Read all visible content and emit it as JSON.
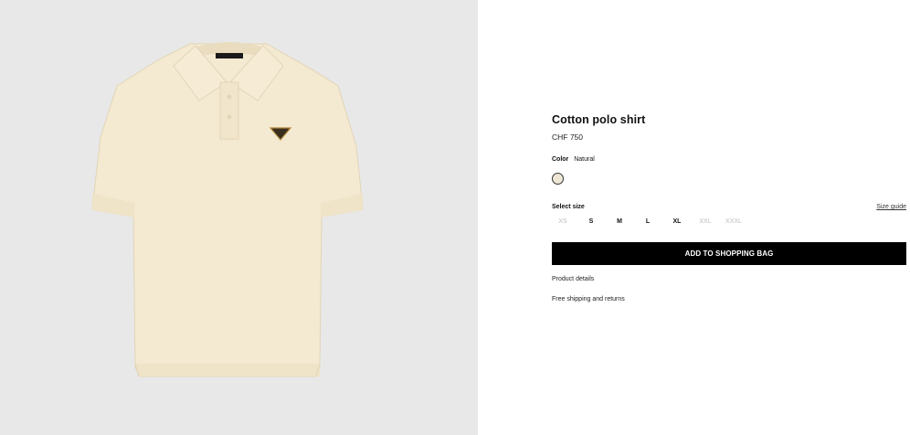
{
  "product": {
    "title": "Cotton polo shirt",
    "price": "CHF 750",
    "image_alt": "polo-shirt-image"
  },
  "color": {
    "label": "Color",
    "value": "Natural",
    "swatch_hex": "#efe7d6"
  },
  "size": {
    "label": "Select size",
    "guide_label": "Size guide",
    "options": [
      {
        "label": "XS",
        "available": false
      },
      {
        "label": "S",
        "available": true
      },
      {
        "label": "M",
        "available": true
      },
      {
        "label": "L",
        "available": true
      },
      {
        "label": "XL",
        "available": true
      },
      {
        "label": "XXL",
        "available": false
      },
      {
        "label": "XXXL",
        "available": false
      }
    ]
  },
  "actions": {
    "add_to_bag": "ADD TO SHOPPING BAG"
  },
  "links": {
    "product_details": "Product details",
    "shipping": "Free shipping and returns"
  },
  "colors": {
    "image_bg": "#e8e8e8",
    "shirt": "#f4e9d1",
    "button_bg": "#000000"
  }
}
